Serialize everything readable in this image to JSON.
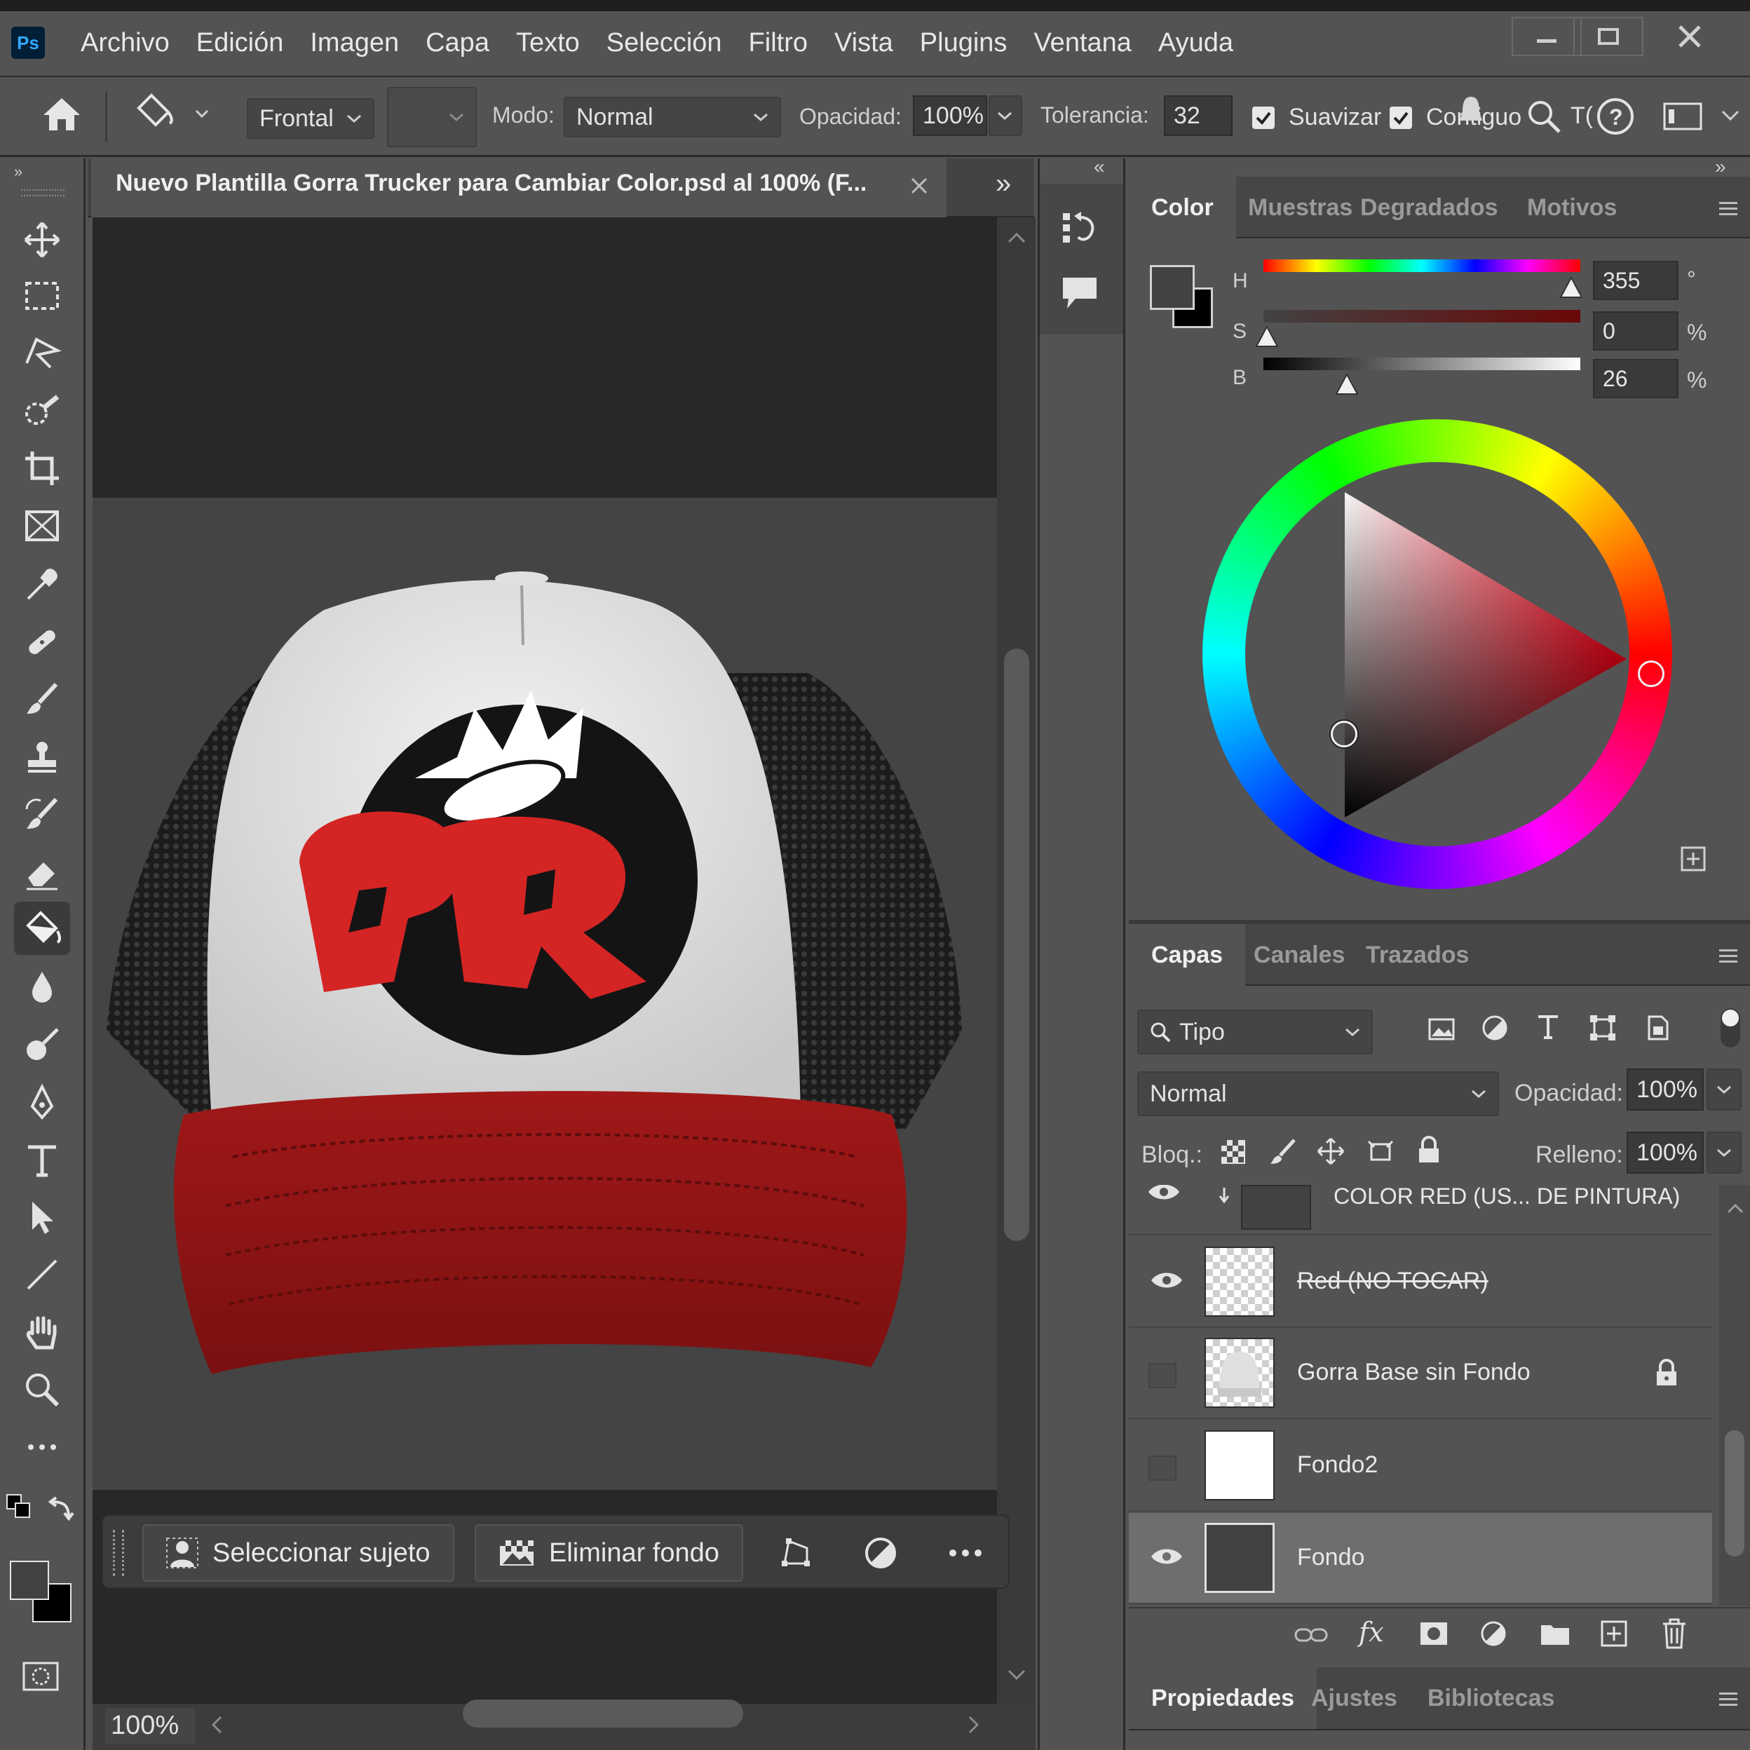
{
  "app": {
    "logo": "Ps"
  },
  "menu": [
    "Archivo",
    "Edición",
    "Imagen",
    "Capa",
    "Texto",
    "Selección",
    "Filtro",
    "Vista",
    "Plugins",
    "Ventana",
    "Ayuda"
  ],
  "options": {
    "mode_source": "Frontal",
    "mode_label": "Modo:",
    "mode_value": "Normal",
    "opacity_label": "Opacidad:",
    "opacity_value": "100%",
    "tolerance_label": "Tolerancia:",
    "tolerance_value": "32",
    "smooth_label": "Suavizar",
    "contiguous_label": "Contiguo",
    "partial_label": "T("
  },
  "document": {
    "tab_title": "Nuevo Plantilla Gorra Trucker para Cambiar Color.psd al 100% (F...",
    "zoom": "100%",
    "logo_text": "PR"
  },
  "contextbar": {
    "select_subject": "Seleccionar sujeto",
    "remove_bg": "Eliminar fondo"
  },
  "color_panel": {
    "tabs": [
      "Color",
      "Muestras",
      "Degradados",
      "Motivos"
    ],
    "h_label": "H",
    "h_value": "355",
    "h_unit": "°",
    "s_label": "S",
    "s_value": "0",
    "s_unit": "%",
    "b_label": "B",
    "b_value": "26",
    "b_unit": "%",
    "foreground": "#424242",
    "background": "#000000"
  },
  "layers_panel": {
    "tabs": [
      "Capas",
      "Canales",
      "Trazados"
    ],
    "filter": "Tipo",
    "blend_mode": "Normal",
    "opacity_label": "Opacidad:",
    "opacity_value": "100%",
    "lock_label": "Bloq.:",
    "fill_label": "Relleno:",
    "fill_value": "100%",
    "layers": [
      {
        "name": "COLOR RED (US... DE PINTURA)",
        "visible": true
      },
      {
        "name": "Red (NO TOCAR)",
        "visible": true
      },
      {
        "name": "Gorra Base sin Fondo",
        "visible": false,
        "locked": true
      },
      {
        "name": "Fondo2",
        "visible": false
      },
      {
        "name": "Fondo",
        "visible": true,
        "selected": true
      }
    ]
  },
  "bottom_panel": {
    "tabs": [
      "Propiedades",
      "Ajustes",
      "Bibliotecas"
    ]
  },
  "colors": {
    "cap_red": "#b01c1c",
    "logo_red": "#d42424",
    "ui_bg": "#535353"
  }
}
